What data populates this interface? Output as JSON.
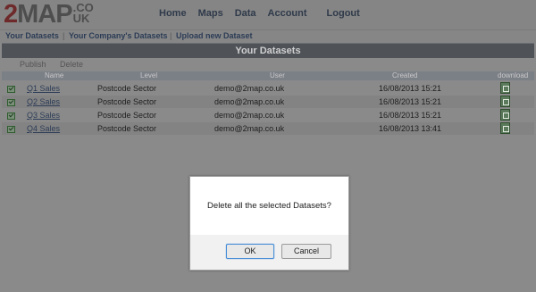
{
  "logo": {
    "two": "2",
    "main": "MAP",
    "co": ".CO",
    "uk": "UK"
  },
  "nav": [
    "Home",
    "Maps",
    "Data",
    "Account",
    "Logout"
  ],
  "subnav": {
    "items": [
      "Your Datasets",
      "Your Company's Datasets",
      "Upload new Dataset"
    ],
    "separator": "|"
  },
  "section_title": "Your Datasets",
  "actions": {
    "publish": "Publish",
    "delete": "Delete"
  },
  "table": {
    "columns": [
      "Name",
      "Level",
      "User",
      "Created",
      "download"
    ],
    "rows": [
      {
        "name": "Q1 Sales",
        "level": "Postcode Sector",
        "user": "demo@2map.co.uk",
        "created": "16/08/2013 15:21"
      },
      {
        "name": "Q2 Sales",
        "level": "Postcode Sector",
        "user": "demo@2map.co.uk",
        "created": "16/08/2013 15:21"
      },
      {
        "name": "Q3 Sales",
        "level": "Postcode Sector",
        "user": "demo@2map.co.uk",
        "created": "16/08/2013 15:21"
      },
      {
        "name": "Q4 Sales",
        "level": "Postcode Sector",
        "user": "demo@2map.co.uk",
        "created": "16/08/2013 13:41"
      }
    ]
  },
  "dialog": {
    "message": "Delete all the selected Datasets?",
    "ok": "OK",
    "cancel": "Cancel"
  },
  "icons": {
    "row_checkbox": "checkbox-checked-icon",
    "download": "spreadsheet-download-icon"
  }
}
